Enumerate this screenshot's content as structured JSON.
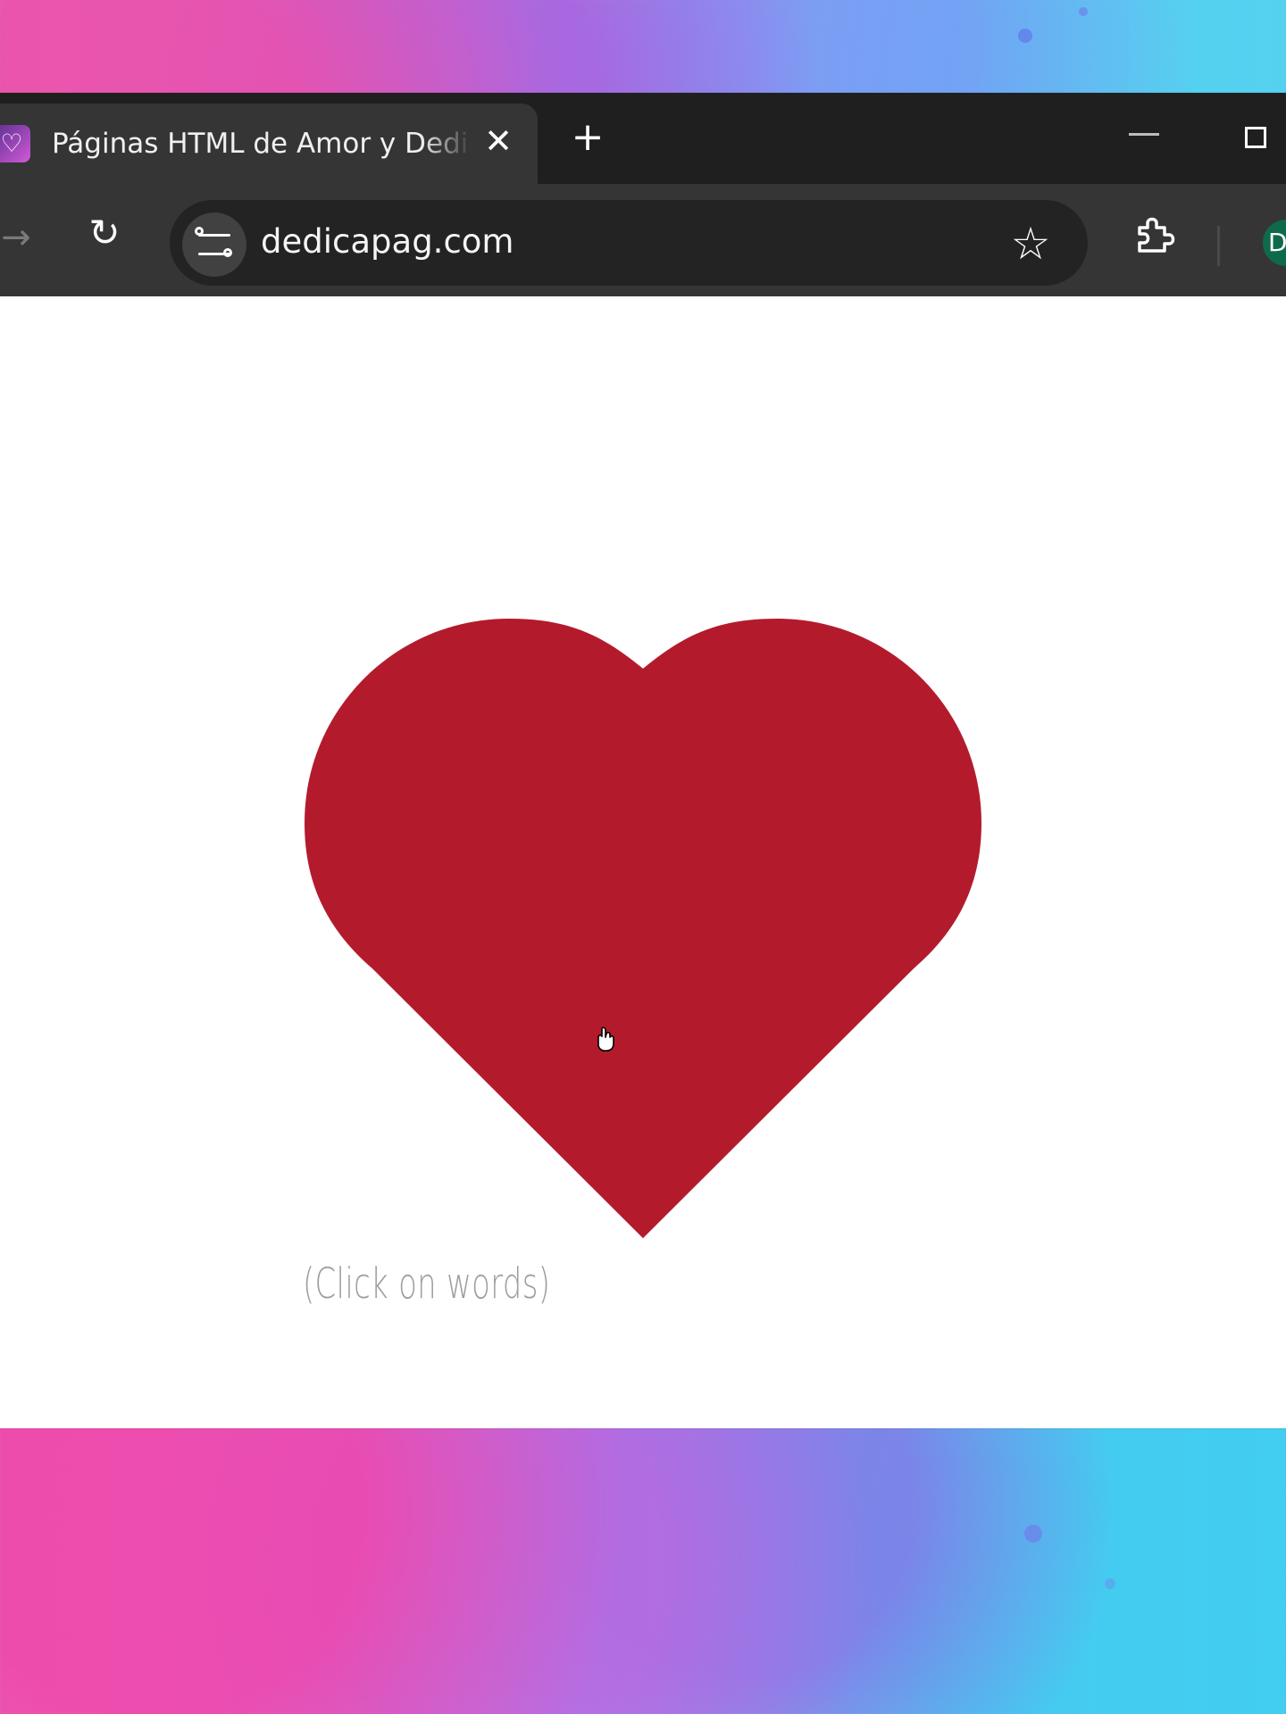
{
  "browser": {
    "tab": {
      "favicon_glyph": "♡",
      "title": "Páginas HTML de Amor y Dedic",
      "close_glyph": "✕"
    },
    "new_tab_glyph": "+",
    "toolbar": {
      "forward_glyph": "→",
      "reload_glyph": "↻",
      "star_glyph": "☆",
      "url": "dedicapag.com",
      "profile_initial": "D"
    }
  },
  "page": {
    "heart_color": "#b31b2d",
    "hint_text": "(Click on words)"
  },
  "colors": {
    "tabstrip": "#1f1f1f",
    "toolbar": "#353535",
    "address_bar": "#232323",
    "profile": "#0f6a4c"
  }
}
